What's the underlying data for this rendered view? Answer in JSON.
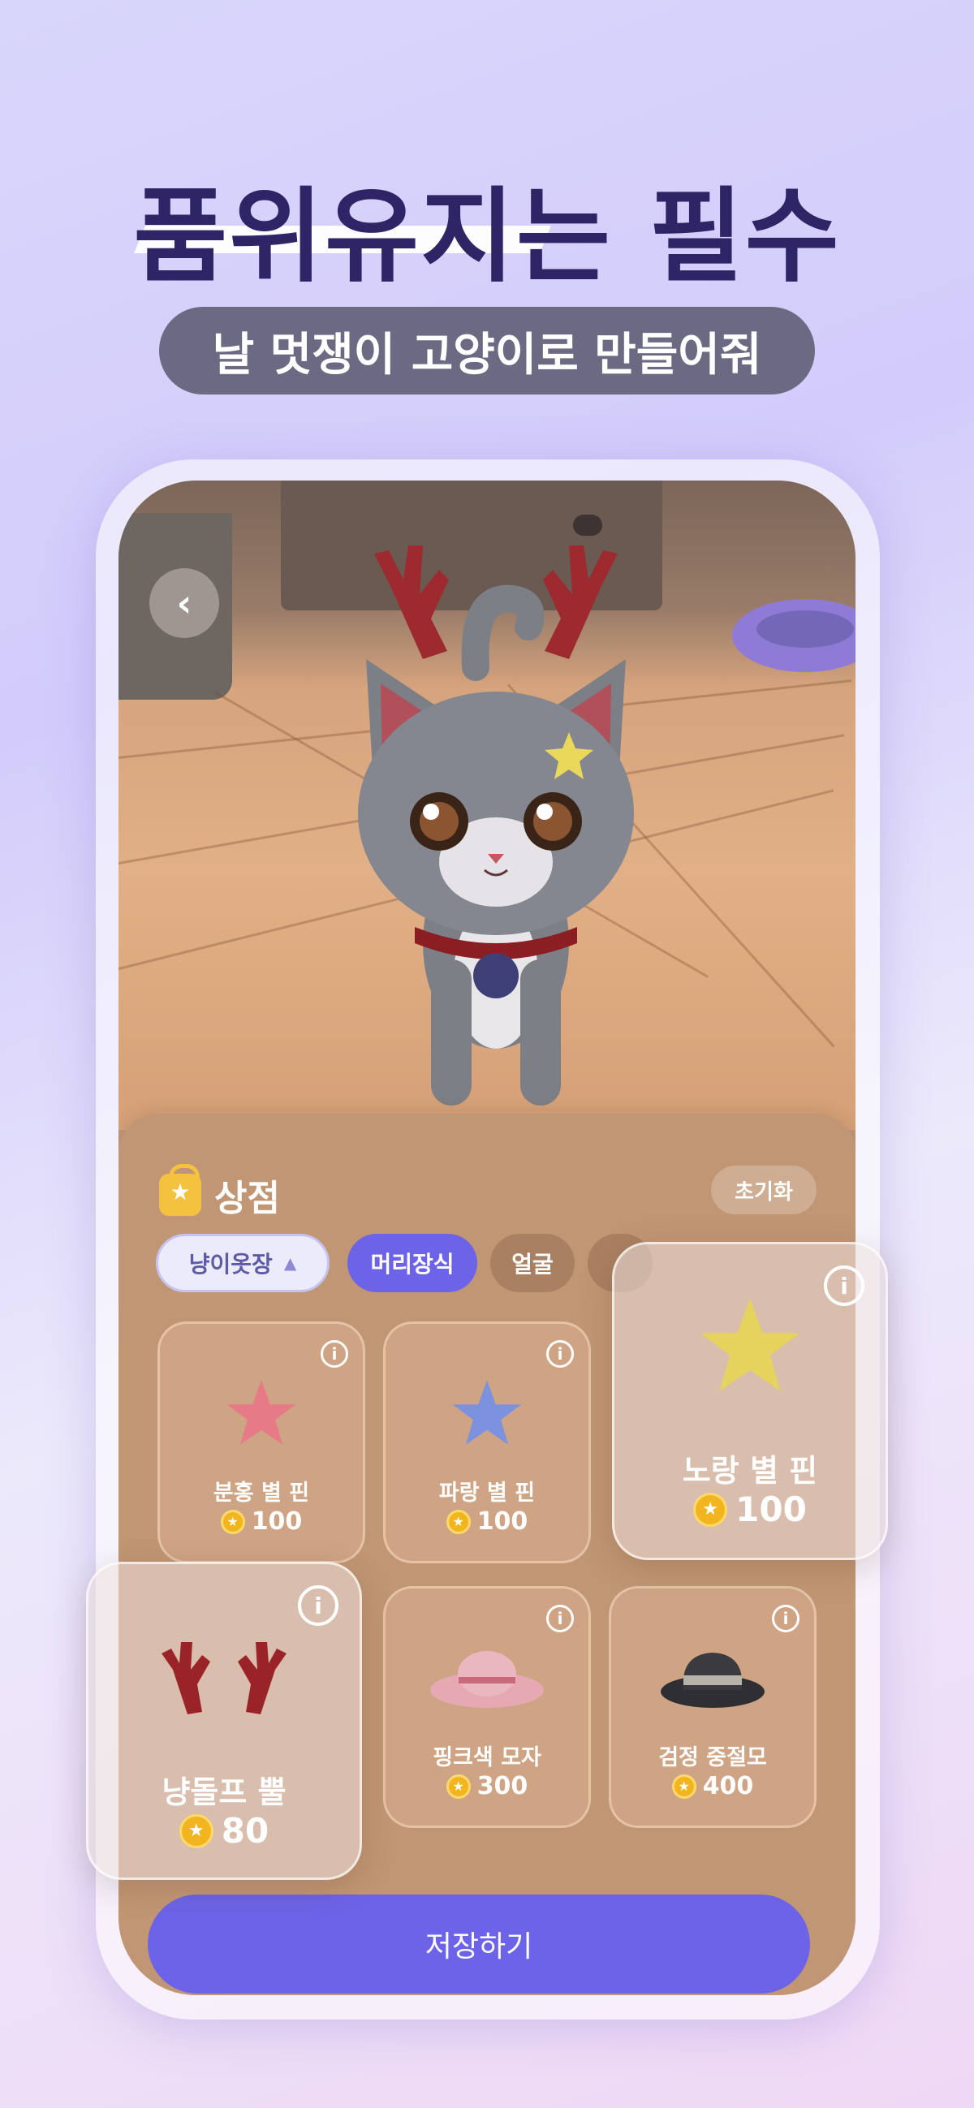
{
  "headline": {
    "title": "품위유지는 필수",
    "subtitle": "날 멋쟁이 고양이로 만들어줘"
  },
  "screen": {
    "back_icon": "chevron-left-icon",
    "shop": {
      "title": "상점",
      "reset_label": "초기화",
      "tabs": [
        {
          "label": "냥이옷장",
          "state": "dropdown"
        },
        {
          "label": "머리장식",
          "state": "active"
        },
        {
          "label": "얼굴",
          "state": "inactive"
        }
      ],
      "items": [
        {
          "name": "분홍 별 핀",
          "price": "100",
          "icon": "pink-star-pin"
        },
        {
          "name": "파랑 별 핀",
          "price": "100",
          "icon": "blue-star-pin"
        },
        {
          "name": "노랑 별 핀",
          "price": "100",
          "icon": "yellow-star-pin"
        },
        {
          "name": "냥돌프 뿔",
          "price": "80",
          "icon": "antlers"
        },
        {
          "name": "핑크색 모자",
          "price": "300",
          "icon": "pink-hat"
        },
        {
          "name": "검정 중절모",
          "price": "400",
          "icon": "black-fedora"
        }
      ],
      "save_label": "저장하기"
    }
  },
  "colors": {
    "accent": "#6c63e8",
    "headline": "#2f2466",
    "coin": "#f3b51f"
  }
}
